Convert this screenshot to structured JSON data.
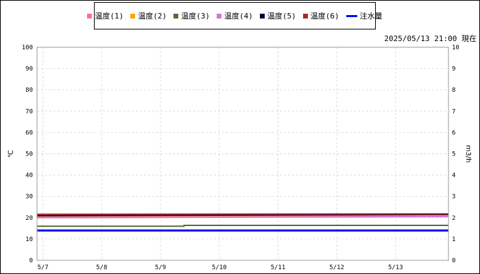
{
  "legend": [
    {
      "label": "温度(1)",
      "color": "#ff69b4",
      "kind": "square"
    },
    {
      "label": "温度(2)",
      "color": "#ffa500",
      "kind": "square"
    },
    {
      "label": "温度(3)",
      "color": "#556b2f",
      "kind": "square"
    },
    {
      "label": "温度(4)",
      "color": "#da70d6",
      "kind": "square"
    },
    {
      "label": "温度(5)",
      "color": "#000033",
      "kind": "square"
    },
    {
      "label": "温度(6)",
      "color": "#a52a2a",
      "kind": "square"
    },
    {
      "label": "注水量",
      "color": "#0000ff",
      "kind": "line"
    }
  ],
  "timestamp": "2025/05/13 21:00 現在",
  "chart_data": {
    "type": "line",
    "title": "",
    "xlabel": "",
    "ylabel": "℃",
    "y2label": "m3/h",
    "ylim": [
      0,
      100
    ],
    "y2lim": [
      0,
      10
    ],
    "yticks": [
      "0",
      "10",
      "20",
      "30",
      "40",
      "50",
      "60",
      "70",
      "80",
      "90",
      "100"
    ],
    "y2ticks": [
      "0",
      "1",
      "2",
      "3",
      "4",
      "5",
      "6",
      "7",
      "8",
      "9",
      "10"
    ],
    "xticks": [
      "5/7",
      "5/8",
      "5/9",
      "5/10",
      "5/11",
      "5/12",
      "5/13"
    ],
    "xlim": [
      -0.1,
      6.9
    ],
    "grid": true,
    "legend_position": "top",
    "series": [
      {
        "name": "温度(1)",
        "color": "#ff69b4",
        "axis": "left",
        "x": [
          -0.1,
          6.9
        ],
        "values": [
          20.0,
          20.5
        ]
      },
      {
        "name": "温度(2)",
        "color": "#ffa500",
        "axis": "left",
        "x": [
          -0.1,
          6.9
        ],
        "values": [
          20.5,
          20.8
        ]
      },
      {
        "name": "温度(3)",
        "color": "#556b2f",
        "axis": "left",
        "x": [
          -0.1,
          2.4,
          2.4,
          6.9
        ],
        "values": [
          16.0,
          16.0,
          16.4,
          16.4
        ]
      },
      {
        "name": "温度(4)",
        "color": "#da70d6",
        "axis": "left",
        "x": [
          -0.1,
          6.9
        ],
        "values": [
          20.2,
          20.6
        ]
      },
      {
        "name": "温度(5)",
        "color": "#000033",
        "axis": "left",
        "x": [
          -0.1,
          6.9
        ],
        "values": [
          21.0,
          21.5
        ]
      },
      {
        "name": "温度(6)",
        "color": "#a52a2a",
        "axis": "left",
        "x": [
          -0.1,
          6.9
        ],
        "values": [
          21.6,
          21.8
        ]
      },
      {
        "name": "注水量",
        "color": "#0000ff",
        "axis": "right",
        "x": [
          -0.1,
          6.9
        ],
        "values": [
          1.4,
          1.4
        ]
      }
    ]
  }
}
